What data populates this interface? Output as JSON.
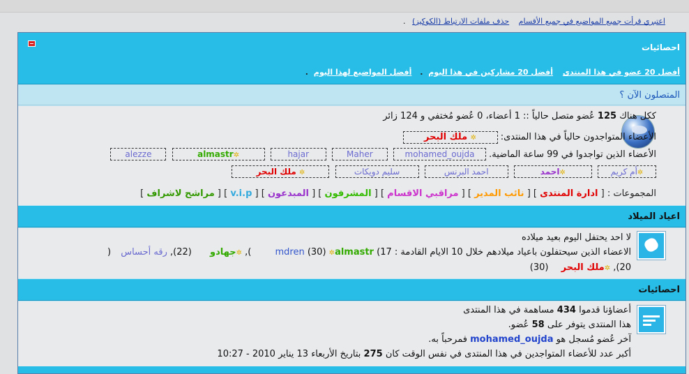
{
  "top_links": {
    "mark_read": "اعتبري قرأت جميع المواضيع في جميع الأقسام",
    "delete_cookies": "حذف ملفات الارتباط (الكوكيز)",
    "trailing": "."
  },
  "stats": {
    "title": "احصائيات",
    "tabs": {
      "top_posters": "أفضل 20 عضو في هذا المنتدى",
      "top_today": "أفضل 20 مشاركين في هذا اليوم",
      "top_topics": "أفضل المواضيع لهذا اليوم"
    },
    "sep": "."
  },
  "online": {
    "title": "المتصلون الآن ؟",
    "summary_prefix": "ككل هناك",
    "summary_count": "125",
    "summary_suffix": "عُضو متصل حالياً :: 1 أعضاء، 0 عُضو مُختفي و 124 زائر",
    "current_label": "الأعضاء المتواجدون حالياً في هذا المنتدى:",
    "current_user": "ملك البحر",
    "past_label": "الأعضاء الذين تواجدوا في 99 ساعة الماضية.",
    "past_users": {
      "u1": "mohamed_oujda",
      "u2": "Maher",
      "u3": "hajar",
      "u4": "almastr",
      "u5": "alezze",
      "u6": "أم كريم",
      "u7": "احمد",
      "u8": "احمد البرنس",
      "u9": "سليم دويكات",
      "u10": "ملك البحر"
    },
    "groups_label": "المجموعات :",
    "groups": {
      "g1": "ادارة المنتدى",
      "g2": "نائب المدير",
      "g3": "مراقبي الاقسام",
      "g4": "المشرفون",
      "g5": "المبدعون",
      "g6": "v.i.p",
      "g7": "مراشح لاشراف"
    }
  },
  "birthdays": {
    "title": "اعياد الميلاد",
    "today": "لا احد يحتفل اليوم بعيد ميلاده",
    "upcoming_prefix": "الاعضاء الذين سيحتفلون باعياد ميلادهم خلال 10 الايام القادمة : 17)",
    "u1": "mdren",
    "a1": "(30)",
    "u2": "almastr",
    "a2": "),",
    "u3": "جهادو",
    "a3": "(22),",
    "u4": "رقه أحساس",
    "a4": "(",
    "a5": "20),",
    "u5": "ملك البحر",
    "a6": "(30)"
  },
  "stats2": {
    "title": "احصائيات",
    "line1_prefix": "أعضاؤنا قدموا",
    "line1_num": "434",
    "line1_suffix": "مساهمة في هذا المنتدى",
    "line2_prefix": "هذا المنتدى يتوفر على",
    "line2_num": "58",
    "line2_suffix": "عُضو.",
    "line3_prefix": "آخر عُضو مُسجل هو",
    "line3_user": "mohamed_oujda",
    "line3_suffix": "فمرحباً به.",
    "line4_prefix": "أكبر عدد للأعضاء المتواجدين في هذا المنتدى في نفس الوقت كان",
    "line4_num": "275",
    "line4_suffix": "بتاريخ الأربعاء 13 يناير 2010 - 10:27"
  },
  "colors": {
    "bar": "#27bde6",
    "row": "#e9eaec",
    "link": "#1a3da8",
    "admin": "#e00000",
    "deputy": "#ff9900",
    "moderator": "#cc33cc",
    "supervisor": "#33bb00",
    "creative": "#9933cc",
    "vip": "#33aadd",
    "candidate": "#339900"
  }
}
